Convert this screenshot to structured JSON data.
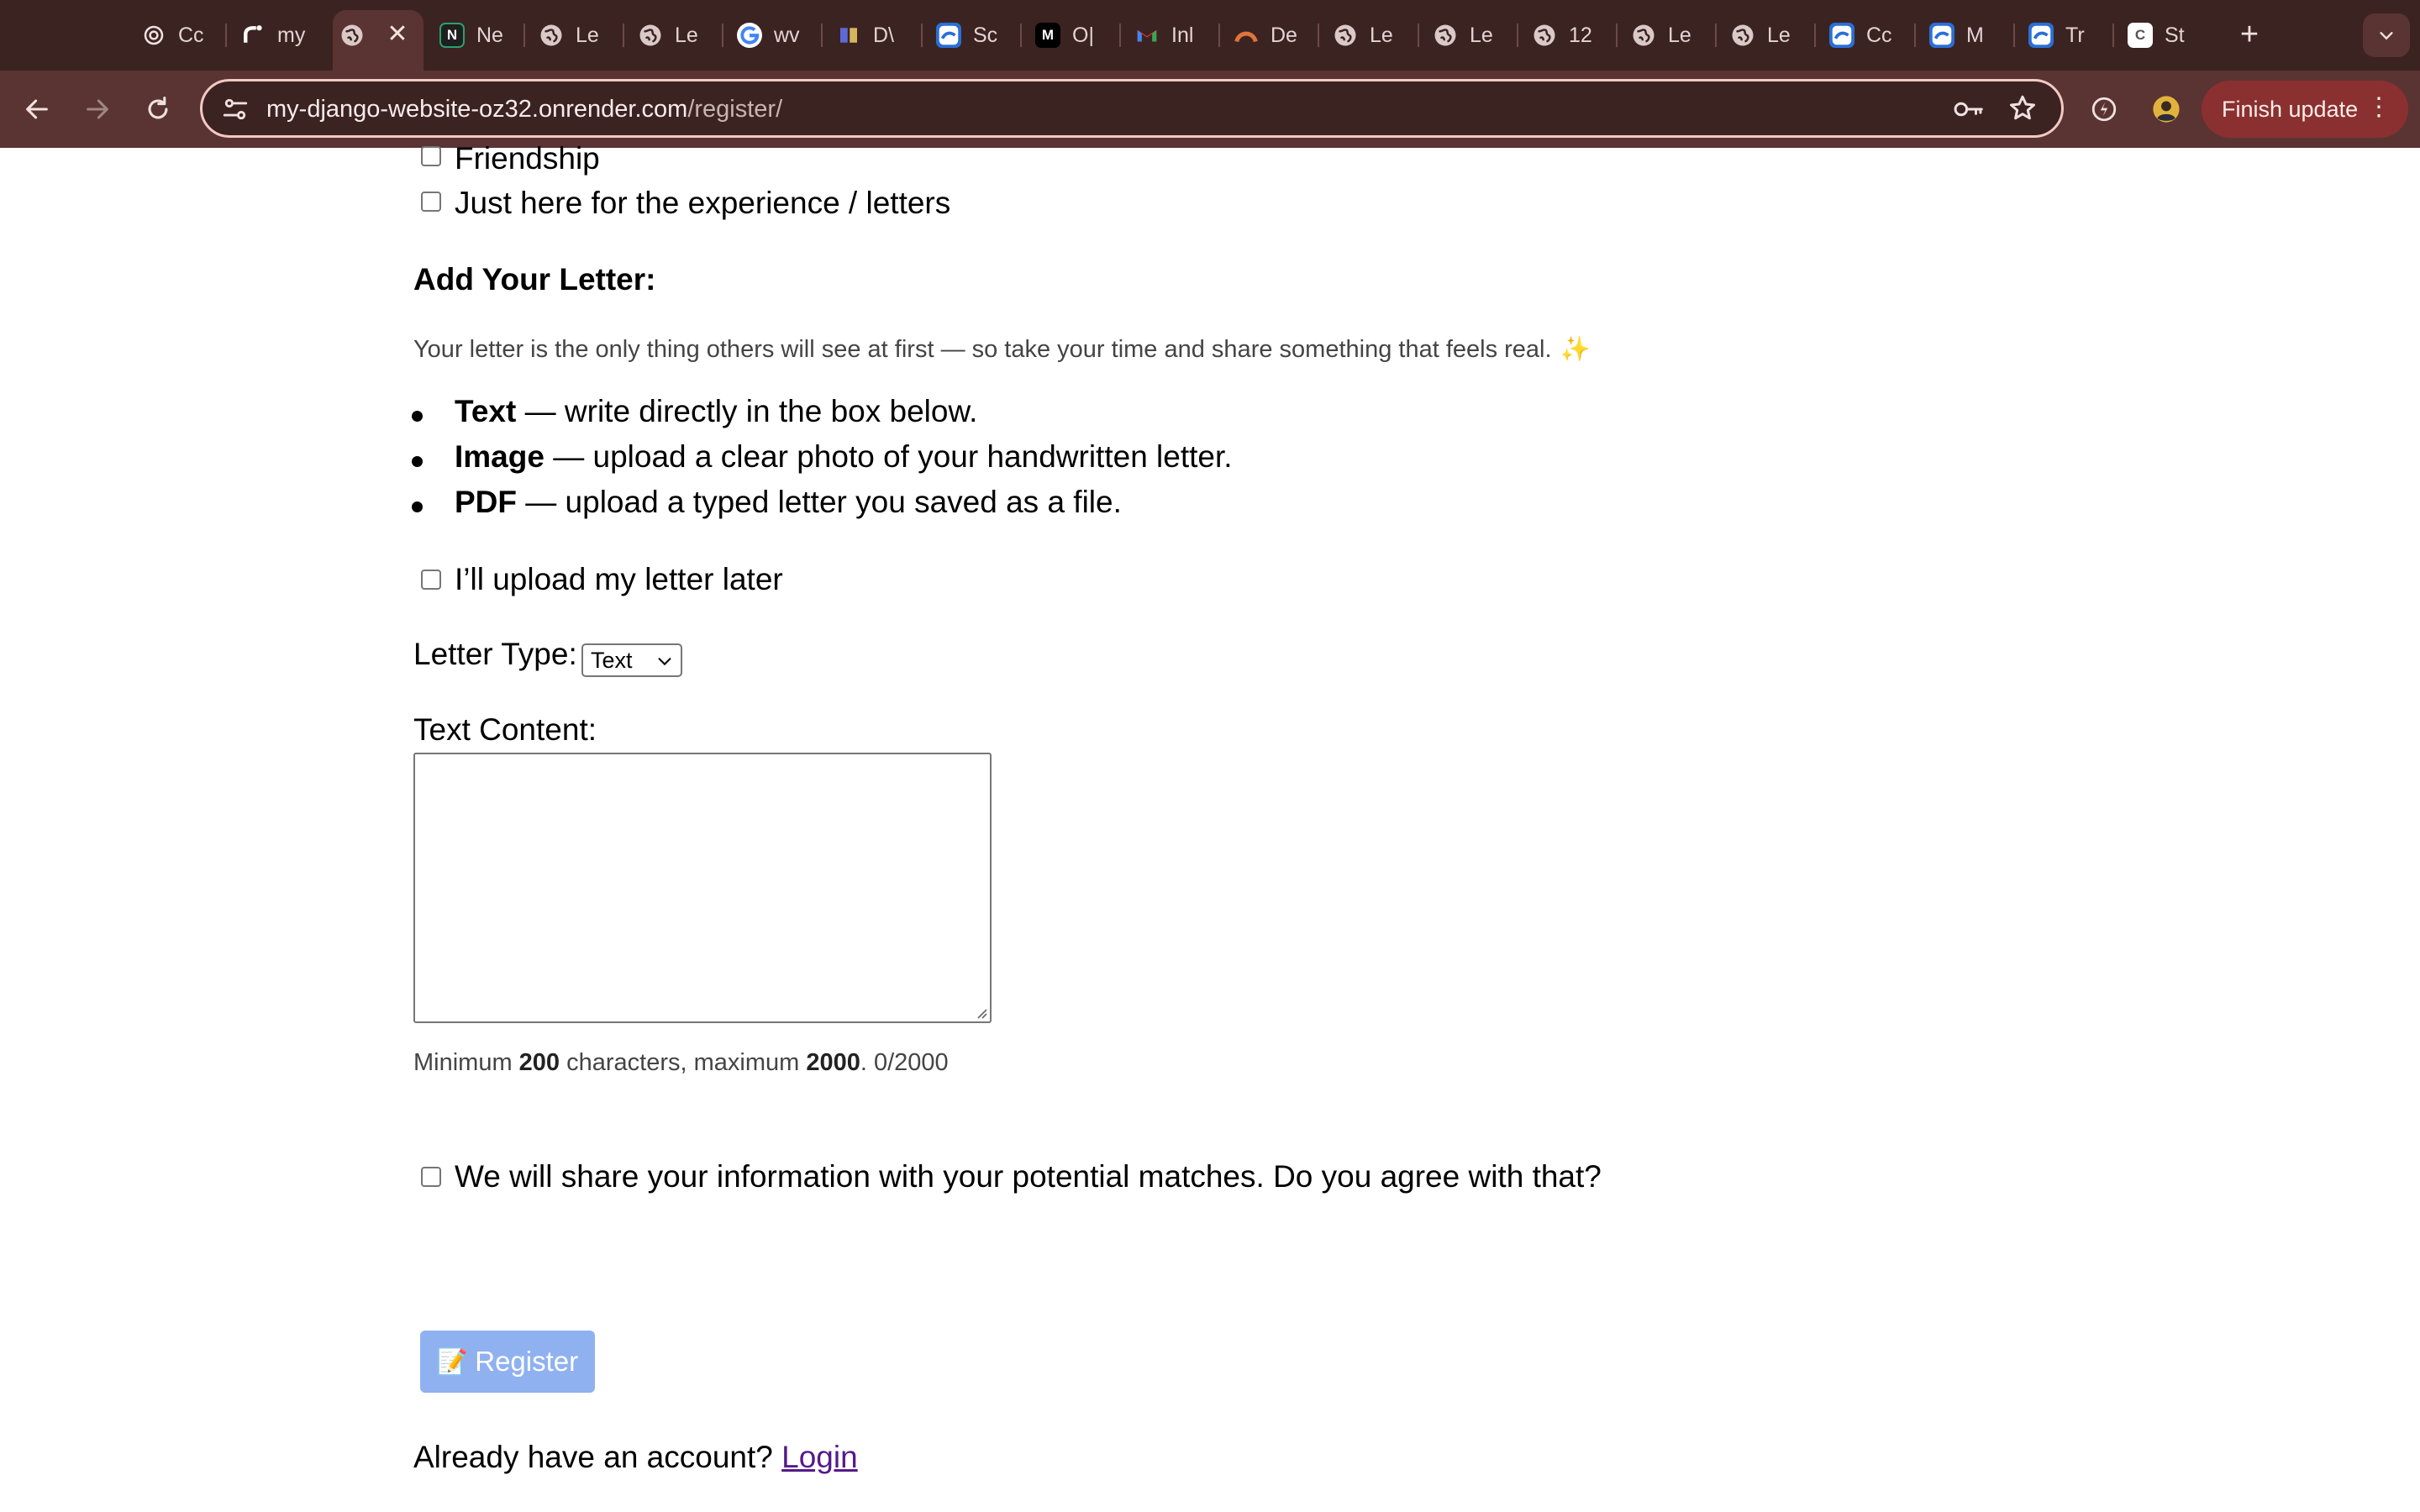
{
  "browser": {
    "tabs": [
      {
        "title": "Cc",
        "icon": "chatgpt-icon"
      },
      {
        "title": "my",
        "icon": "render-icon"
      },
      {
        "title": "",
        "icon": "globe-icon",
        "active": true
      },
      {
        "title": "Ne",
        "icon": "notion-icon"
      },
      {
        "title": "Le",
        "icon": "globe-icon"
      },
      {
        "title": "Le",
        "icon": "globe-icon"
      },
      {
        "title": "wv",
        "icon": "google-icon"
      },
      {
        "title": "D\\",
        "icon": "dv-icon"
      },
      {
        "title": "Sc",
        "icon": "app-icon"
      },
      {
        "title": "O|",
        "icon": "medium-icon"
      },
      {
        "title": "Inl",
        "icon": "gmail-icon"
      },
      {
        "title": "De",
        "icon": "arc-icon"
      },
      {
        "title": "Le",
        "icon": "globe-icon"
      },
      {
        "title": "Le",
        "icon": "globe-icon"
      },
      {
        "title": "12",
        "icon": "globe-icon"
      },
      {
        "title": "Le",
        "icon": "globe-icon"
      },
      {
        "title": "Le",
        "icon": "globe-icon"
      },
      {
        "title": "Cc",
        "icon": "app-icon"
      },
      {
        "title": "M",
        "icon": "app-icon"
      },
      {
        "title": "Tr",
        "icon": "app-icon"
      },
      {
        "title": "St",
        "icon": "c-icon"
      }
    ],
    "active_tab_close": "✕",
    "new_tab_label": "+",
    "url_host": "my-django-website-oz32.onrender.com",
    "url_path": "/register/",
    "finish_update_label": "Finish update",
    "colors": {
      "tabstrip": "#3b2321",
      "toolbar": "#5a3432",
      "update_button": "#8a3030",
      "omnibox_border": "#f2c9c4"
    }
  },
  "form": {
    "checkbox_friendship": "Friendship",
    "checkbox_experience": "Just here for the experience / letters",
    "letter_heading": "Add Your Letter:",
    "letter_intro": "Your letter is the only thing others will see at first — so take your time and share something that feels real.",
    "letter_intro_emoji": "✨",
    "letter_options": [
      {
        "bold": "Text",
        "rest": " — write directly in the box below."
      },
      {
        "bold": "Image",
        "rest": " — upload a clear photo of your handwritten letter."
      },
      {
        "bold": "PDF",
        "rest": " — upload a typed letter you saved as a file."
      }
    ],
    "upload_later_label": "I’ll upload my letter later",
    "letter_type_label": "Letter Type:",
    "letter_type_value": "Text",
    "text_content_label": "Text Content:",
    "text_content_value": "",
    "hint_prefix": "Minimum ",
    "hint_min": "200",
    "hint_middle": " characters, maximum ",
    "hint_max": "2000",
    "hint_suffix": ". 0/2000",
    "agree_label": "We will share your information with your potential matches. Do you agree with that?",
    "register_emoji": "📝",
    "register_label": "Register",
    "login_prompt": "Already have an account? ",
    "login_link": "Login",
    "colors": {
      "register_button": "#8fb1f0",
      "link": "#551a8b"
    }
  }
}
